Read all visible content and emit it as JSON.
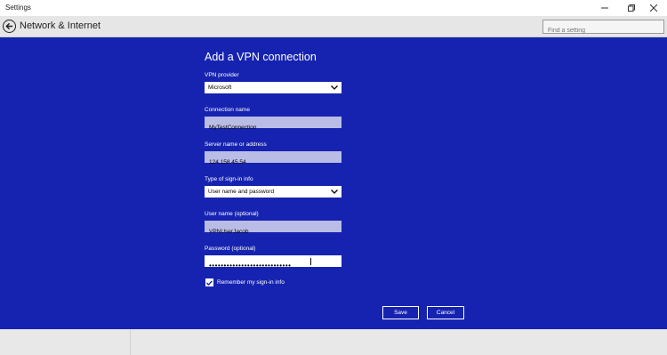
{
  "window": {
    "title": "Settings",
    "minimize_glyph": "—",
    "maximize_glyph": "❐",
    "close_glyph": "✕"
  },
  "header": {
    "title": "Network & Internet",
    "search": {
      "placeholder": "Find a setting",
      "value": ""
    }
  },
  "dialog": {
    "title": "Add a VPN connection",
    "vpn_provider": {
      "label": "VPN provider",
      "value": "Microsoft"
    },
    "connection_name": {
      "label": "Connection name",
      "value": "MyTestConnection"
    },
    "server": {
      "label": "Server name or address",
      "value": "124.158.45.54"
    },
    "signin_type": {
      "label": "Type of sign-in info",
      "value": "User name and password"
    },
    "username": {
      "label": "User name (optional)",
      "value": "VPNUserJacob"
    },
    "password": {
      "label": "Password (optional)",
      "value": "••••••••••••••••••••••••••••"
    },
    "remember": {
      "label": "Remember my sign-in info",
      "checked": true
    },
    "save_label": "Save",
    "cancel_label": "Cancel"
  },
  "colors": {
    "dialog_bg": "#1623b0",
    "text_field_bg": "#b9bde6",
    "chrome_bg": "#e6e6e6"
  },
  "icons": [
    "back-arrow-icon",
    "search-icon",
    "chevron-down-icon",
    "checkmark-icon",
    "minimize-icon",
    "maximize-icon",
    "close-icon"
  ]
}
